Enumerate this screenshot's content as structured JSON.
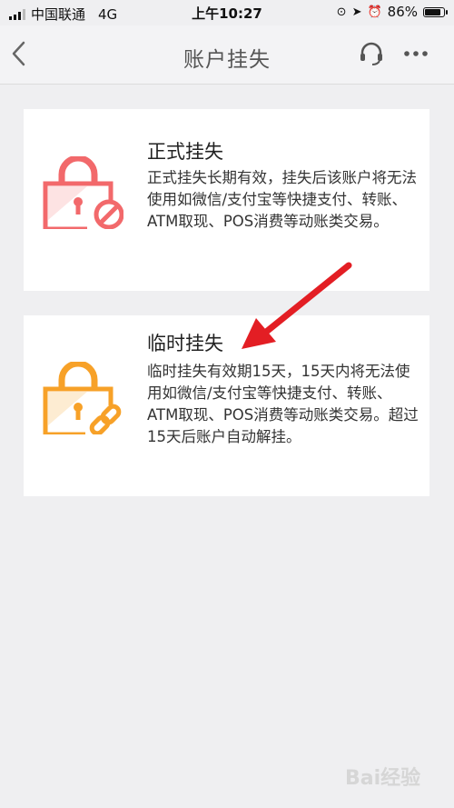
{
  "status_bar": {
    "carrier": "中国联通",
    "network": "4G",
    "time": "上午10:27",
    "battery": "86%",
    "battery_level": 0.86
  },
  "header": {
    "back_icon": "chevron-left-icon",
    "title": "账户挂失",
    "support_icon": "headset-icon",
    "more_icon": "more-dots-icon"
  },
  "options": [
    {
      "title": "正式挂失",
      "description": "正式挂失长期有效，挂失后该账户将无法使用如微信/支付宝等快捷支付、转账、ATM取现、POS消费等动账类交易。",
      "icon": "lock-blocked-icon",
      "color": "#f2696b"
    },
    {
      "title": "临时挂失",
      "description": "临时挂失有效期15天，15天内将无法使用如微信/支付宝等快捷支付、转账、ATM取现、POS消费等动账类交易。超过15天后账户自动解挂。",
      "icon": "lock-link-icon",
      "color": "#f7a128"
    }
  ],
  "colors": {
    "annotation_arrow": "#e31e24",
    "background": "#efeff1"
  },
  "watermark": "Bai经验"
}
